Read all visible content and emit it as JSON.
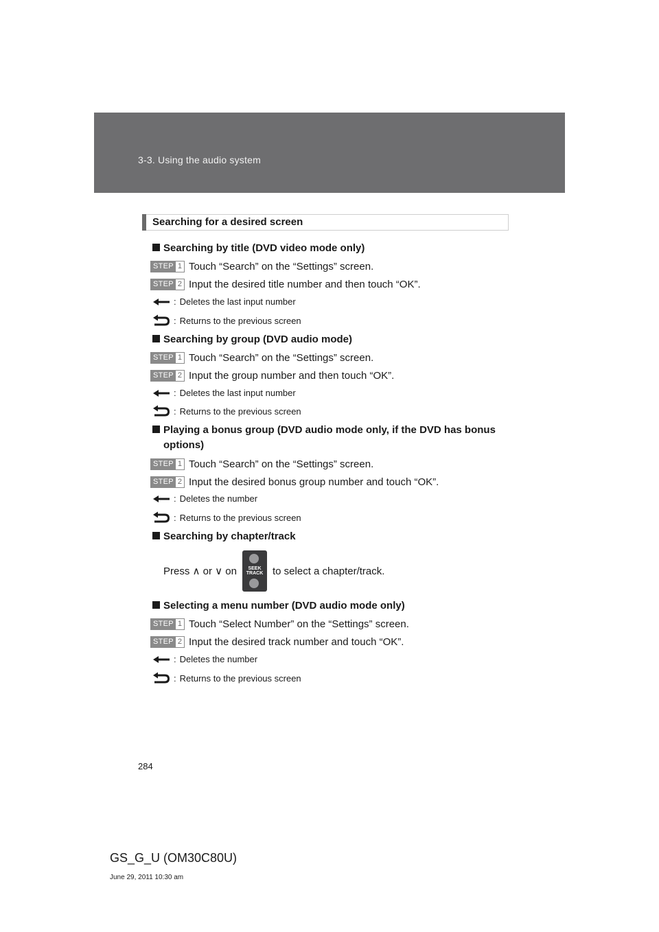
{
  "header": {
    "section": "3-3. Using the audio system"
  },
  "section_title": "Searching for a desired screen",
  "step_label": "STEP",
  "icons": {
    "backspace": "backspace-arrow-icon",
    "return": "return-arrow-icon"
  },
  "blocks": {
    "title": {
      "heading": "Searching by title (DVD video mode only)",
      "step1": {
        "num": "1",
        "text": "Touch “Search” on the “Settings” screen."
      },
      "step2": {
        "num": "2",
        "text": "Input the desired title number and then touch “OK”."
      },
      "del": "Deletes the last input number",
      "ret": "Returns to the previous screen"
    },
    "group": {
      "heading": "Searching by group (DVD audio mode)",
      "step1": {
        "num": "1",
        "text": "Touch “Search” on the “Settings” screen."
      },
      "step2": {
        "num": "2",
        "text": "Input the group number and then touch “OK”."
      },
      "del": "Deletes the last input number",
      "ret": "Returns to the previous screen"
    },
    "bonus": {
      "heading_line1": "Playing a bonus group (DVD audio mode only, if the DVD has bonus",
      "heading_line2": "options)",
      "step1": {
        "num": "1",
        "text": "Touch “Search” on the “Settings” screen."
      },
      "step2": {
        "num": "2",
        "text": "Input the desired bonus group number and touch “OK”."
      },
      "del": "Deletes the number",
      "ret": "Returns to the previous screen"
    },
    "chapter": {
      "heading": "Searching by chapter/track",
      "press_before": "Press ∧ or ∨ on",
      "button_label_1": "SEEK",
      "button_label_2": "TRACK",
      "press_after": "to select a chapter/track."
    },
    "menu": {
      "heading": "Selecting a menu number (DVD audio mode only)",
      "step1": {
        "num": "1",
        "text": "Touch “Select Number” on the “Settings” screen."
      },
      "step2": {
        "num": "2",
        "text": "Input the desired track number and touch “OK”."
      },
      "del": "Deletes the number",
      "ret": "Returns to the previous screen"
    }
  },
  "footer": {
    "page_number": "284",
    "code": "GS_G_U (OM30C80U)",
    "date": "June 29, 2011 10:30 am"
  }
}
